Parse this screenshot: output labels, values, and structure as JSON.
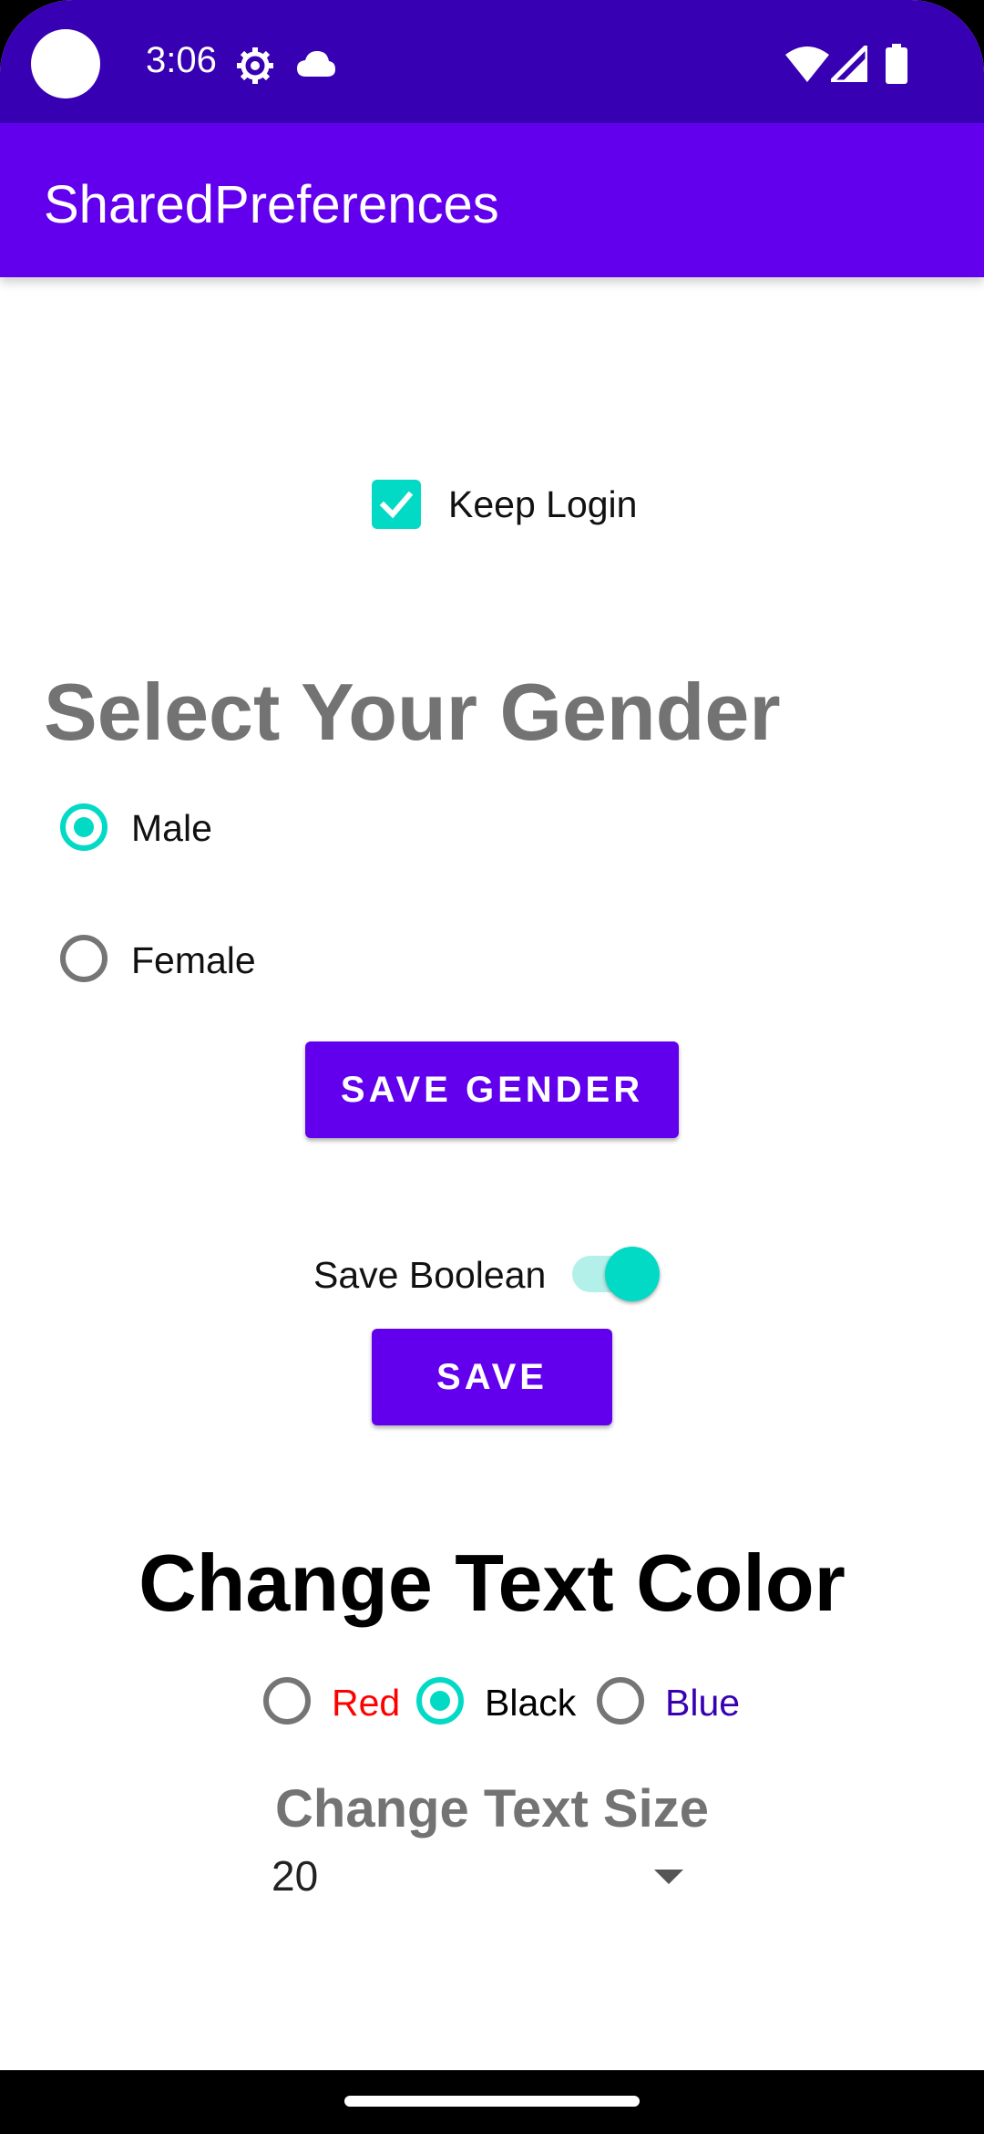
{
  "status_bar": {
    "time": "3:06",
    "icons": [
      "settings-gear-icon",
      "cloud-icon",
      "wifi-icon",
      "signal-icon",
      "battery-icon"
    ],
    "color": "#3700B3"
  },
  "app_bar": {
    "title": "SharedPreferences",
    "color": "#6200EE"
  },
  "keep_login": {
    "label": "Keep Login",
    "checked": true
  },
  "gender": {
    "title": "Select Your Gender",
    "options": [
      {
        "label": "Male",
        "selected": true
      },
      {
        "label": "Female",
        "selected": false
      }
    ],
    "save_button": "SAVE GENDER"
  },
  "boolean_setting": {
    "label": "Save Boolean",
    "on": true,
    "save_button": "SAVE"
  },
  "text_color": {
    "title": "Change Text Color",
    "options": [
      {
        "label": "Red",
        "color": "#FF0000",
        "selected": false
      },
      {
        "label": "Black",
        "color": "#000000",
        "selected": true
      },
      {
        "label": "Blue",
        "color": "#3700B3",
        "selected": false
      }
    ]
  },
  "text_size": {
    "title": "Change Text Size",
    "value": "20"
  },
  "colors": {
    "accent": "#03DAC5",
    "primary": "#6200EE",
    "primary_dark": "#3700B3"
  }
}
